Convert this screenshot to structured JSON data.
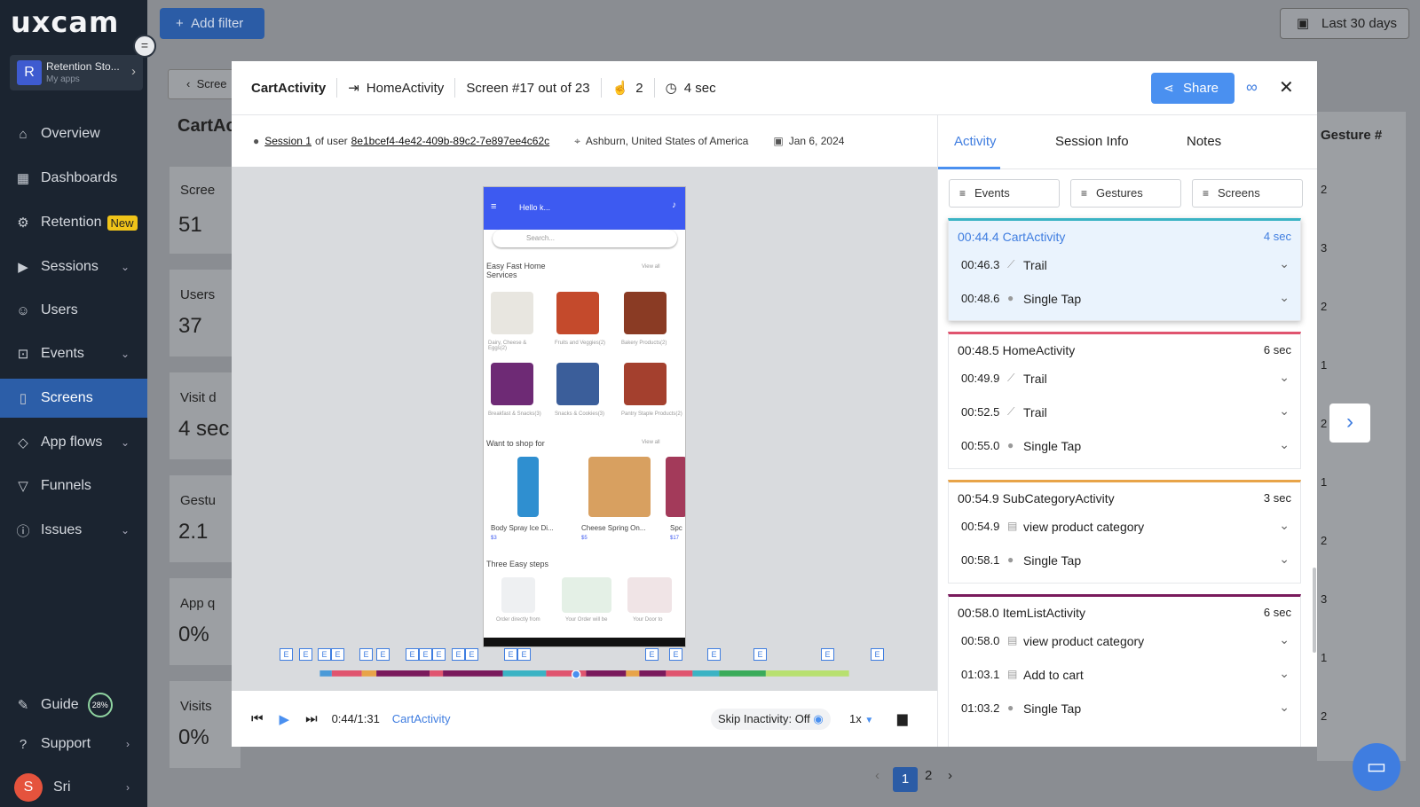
{
  "app": {
    "logo": "uxcam",
    "app_name": "Retention Sto...",
    "app_sub": "My apps"
  },
  "sidebar": {
    "items": [
      {
        "label": "Overview",
        "icon": "home-icon"
      },
      {
        "label": "Dashboards",
        "icon": "dashboard-icon"
      },
      {
        "label": "Retention",
        "icon": "retention-icon",
        "badge": "New"
      },
      {
        "label": "Sessions",
        "icon": "sessions-icon"
      },
      {
        "label": "Users",
        "icon": "users-icon"
      },
      {
        "label": "Events",
        "icon": "events-icon"
      },
      {
        "label": "Screens",
        "icon": "screens-icon"
      },
      {
        "label": "App flows",
        "icon": "appflows-icon"
      },
      {
        "label": "Funnels",
        "icon": "funnel-icon"
      },
      {
        "label": "Issues",
        "icon": "issues-icon"
      }
    ],
    "guide": {
      "label": "Guide",
      "progress": "28%"
    },
    "support": "Support",
    "user": {
      "initial": "S",
      "name": "Sri"
    }
  },
  "topbar": {
    "add_filter": "Add filter",
    "date_range": "Last 30 days"
  },
  "background": {
    "back_label": "Scree",
    "page_title": "CartAc",
    "stats": [
      {
        "label": "Scree",
        "value": "51"
      },
      {
        "label": "Users",
        "value": "37"
      },
      {
        "label": "Visit d",
        "value": "4 sec"
      },
      {
        "label": "Gestu",
        "value": "2.1"
      },
      {
        "label": "App q",
        "value": "0%"
      },
      {
        "label": "Visits",
        "value": "0%"
      }
    ],
    "gesture_header": "Gesture #",
    "gesture_values": [
      "2",
      "3",
      "2",
      "1",
      "2",
      "1",
      "2",
      "3",
      "1",
      "2"
    ],
    "pagination": [
      "1",
      "2"
    ]
  },
  "modal": {
    "screen_name": "CartActivity",
    "next_screen": "HomeActivity",
    "screen_index": "Screen #17 out of 23",
    "gestures": "2",
    "duration": "4 sec",
    "share": "Share",
    "session_link": "Session 1",
    "of_user": "of user",
    "user_id": "8e1bcef4-4e42-409b-89c2-7e897ee4c62c",
    "location": "Ashburn, United States of America",
    "date": "Jan 6, 2024",
    "player": {
      "time": "0:44/1:31",
      "current_screen": "CartActivity",
      "skip_inactivity": "Skip Inactivity: Off",
      "speed": "1x",
      "progress": 0.484
    },
    "phone": {
      "greeting": "Hello k...",
      "search_placeholder": "Search...",
      "section1": "Easy Fast Home Services",
      "view_all": "View all",
      "cats": [
        "Dairy, Cheese & Eggs(2)",
        "Fruits and Veggies(2)",
        "Bakery Products(2)",
        "Breakfast & Snacks(3)",
        "Snacks & Cookies(3)",
        "Pantry Staple Products(2)"
      ],
      "section2": "Want to shop for",
      "items": [
        "Body Spray Ice Di...",
        "Cheese Spring On...",
        "Spc"
      ],
      "prices": [
        "$3",
        "$5",
        "$17"
      ],
      "section3": "Three Easy steps",
      "steps": [
        "Order directly from",
        "Your Order will be",
        "Your Door to"
      ]
    },
    "e_marker": "E"
  },
  "activity": {
    "tabs": [
      "Activity",
      "Session Info",
      "Notes"
    ],
    "filters": [
      "Events",
      "Gestures",
      "Screens"
    ],
    "cards": [
      {
        "time": "00:44.4",
        "screen": "CartActivity",
        "duration": "4 sec",
        "color": "#3ab3c4",
        "events": [
          {
            "time": "00:46.3",
            "icon": "trail-icon",
            "label": "Trail"
          },
          {
            "time": "00:48.6",
            "icon": "tap-icon",
            "label": "Single Tap"
          }
        ]
      },
      {
        "time": "00:48.5",
        "screen": "HomeActivity",
        "duration": "6 sec",
        "color": "#e0546f",
        "events": [
          {
            "time": "00:49.9",
            "icon": "trail-icon",
            "label": "Trail"
          },
          {
            "time": "00:52.5",
            "icon": "trail-icon",
            "label": "Trail"
          },
          {
            "time": "00:55.0",
            "icon": "tap-icon",
            "label": "Single Tap"
          }
        ]
      },
      {
        "time": "00:54.9",
        "screen": "SubCategoryActivity",
        "duration": "3 sec",
        "color": "#e8a449",
        "events": [
          {
            "time": "00:54.9",
            "icon": "event-icon",
            "label": "view product category"
          },
          {
            "time": "00:58.1",
            "icon": "tap-icon",
            "label": "Single Tap"
          }
        ]
      },
      {
        "time": "00:58.0",
        "screen": "ItemListActivity",
        "duration": "6 sec",
        "color": "#7a1a5c",
        "events": [
          {
            "time": "00:58.0",
            "icon": "event-icon",
            "label": "view product category"
          },
          {
            "time": "01:03.1",
            "icon": "event-icon",
            "label": "Add to cart"
          },
          {
            "time": "01:03.2",
            "icon": "tap-icon",
            "label": "Single Tap"
          }
        ]
      }
    ]
  },
  "colors": {
    "accent": "#3f7de0",
    "sidebar": "#1b2430",
    "active_nav": "#2c5ea8"
  }
}
